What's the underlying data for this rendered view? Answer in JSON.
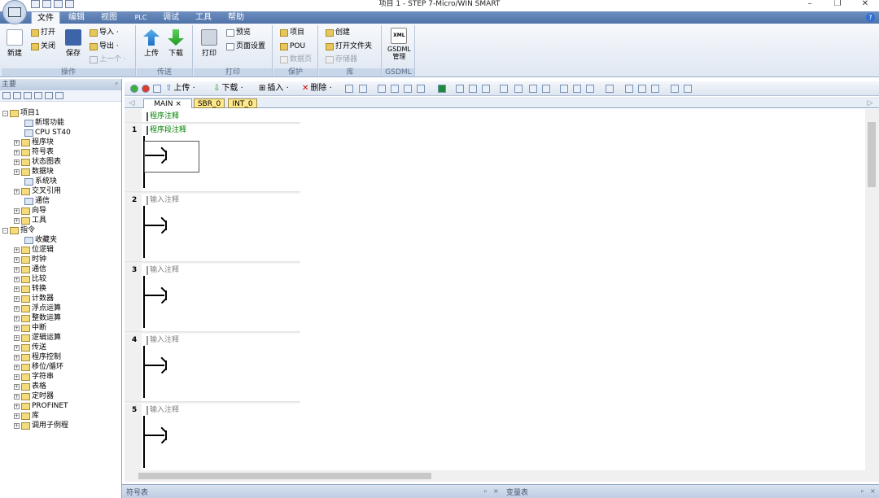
{
  "window": {
    "title": "项目 1 - STEP 7-Micro/WIN SMART",
    "min": "–",
    "restore": "❐",
    "close": "✕"
  },
  "menu": [
    "文件",
    "编辑",
    "视图",
    "PLC",
    "调试",
    "工具",
    "帮助"
  ],
  "help": "?",
  "ribbon": {
    "groups": [
      {
        "label": "操作"
      },
      {
        "label": "传送"
      },
      {
        "label": "打印"
      },
      {
        "label": "保护"
      },
      {
        "label": "库"
      },
      {
        "label": "GSDML"
      }
    ],
    "new": "新建",
    "open": "打开",
    "close": "关闭",
    "save": "保存",
    "import": "导入 ·",
    "export": "导出 ·",
    "prev": "上一个 ·",
    "upload": "上传",
    "download": "下载",
    "print": "打印",
    "preview": "预览",
    "page_setup": "页面设置",
    "project": "项目",
    "pou": "POU",
    "data_page": "数据页",
    "create": "创建",
    "open_folder": "打开文件夹",
    "memory": "存储器",
    "gsdml_line1": "GSDML",
    "gsdml_line2": "管理",
    "xml": "XML"
  },
  "left_panel": {
    "header": "主要",
    "tree": [
      {
        "label": "项目1",
        "x": 3,
        "exp": "-",
        "icon": true
      },
      {
        "label": "新增功能",
        "x": 30
      },
      {
        "label": "CPU ST40",
        "x": 30
      },
      {
        "label": "程序块",
        "x": 17,
        "exp": "+",
        "icon": true
      },
      {
        "label": "符号表",
        "x": 17,
        "exp": "+",
        "icon": true
      },
      {
        "label": "状态图表",
        "x": 17,
        "exp": "+",
        "icon": true
      },
      {
        "label": "数据块",
        "x": 17,
        "exp": "+",
        "icon": true
      },
      {
        "label": "系统块",
        "x": 30
      },
      {
        "label": "交叉引用",
        "x": 17,
        "exp": "+",
        "icon": true
      },
      {
        "label": "通信",
        "x": 30
      },
      {
        "label": "向导",
        "x": 17,
        "exp": "+",
        "icon": true
      },
      {
        "label": "工具",
        "x": 17,
        "exp": "+",
        "icon": true
      },
      {
        "label": "指令",
        "x": 3,
        "exp": "-",
        "icon": true
      },
      {
        "label": "收藏夹",
        "x": 30
      },
      {
        "label": "位逻辑",
        "x": 17,
        "exp": "+",
        "icon": true
      },
      {
        "label": "时钟",
        "x": 17,
        "exp": "+",
        "icon": true
      },
      {
        "label": "通信",
        "x": 17,
        "exp": "+",
        "icon": true
      },
      {
        "label": "比较",
        "x": 17,
        "exp": "+",
        "icon": true
      },
      {
        "label": "转换",
        "x": 17,
        "exp": "+",
        "icon": true
      },
      {
        "label": "计数器",
        "x": 17,
        "exp": "+",
        "icon": true
      },
      {
        "label": "浮点运算",
        "x": 17,
        "exp": "+",
        "icon": true
      },
      {
        "label": "整数运算",
        "x": 17,
        "exp": "+",
        "icon": true
      },
      {
        "label": "中断",
        "x": 17,
        "exp": "+",
        "icon": true
      },
      {
        "label": "逻辑运算",
        "x": 17,
        "exp": "+",
        "icon": true
      },
      {
        "label": "传送",
        "x": 17,
        "exp": "+",
        "icon": true
      },
      {
        "label": "程序控制",
        "x": 17,
        "exp": "+",
        "icon": true
      },
      {
        "label": "移位/循环",
        "x": 17,
        "exp": "+",
        "icon": true
      },
      {
        "label": "字符串",
        "x": 17,
        "exp": "+",
        "icon": true
      },
      {
        "label": "表格",
        "x": 17,
        "exp": "+",
        "icon": true
      },
      {
        "label": "定时器",
        "x": 17,
        "exp": "+",
        "icon": true
      },
      {
        "label": "PROFINET",
        "x": 17,
        "exp": "+",
        "icon": true
      },
      {
        "label": "库",
        "x": 17,
        "exp": "+",
        "icon": true
      },
      {
        "label": "调用子例程",
        "x": 17,
        "exp": "+",
        "icon": true
      }
    ]
  },
  "toolbar": {
    "upload": "上传 ·",
    "download": "下载 ·",
    "insert": "插入 ·",
    "delete": "删除 ·"
  },
  "tabs": {
    "main": "MAIN",
    "close": "×",
    "sbr": "SBR_0",
    "int": "INT_0",
    "left_arrow": "◁",
    "right_arrow": "▷"
  },
  "editor": {
    "program_comment": "程序注释",
    "rungs": [
      {
        "num": "1",
        "comment": "程序段注释"
      },
      {
        "num": "2",
        "comment": "输入注释"
      },
      {
        "num": "3",
        "comment": "输入注释"
      },
      {
        "num": "4",
        "comment": "输入注释"
      },
      {
        "num": "5",
        "comment": "输入注释"
      }
    ]
  },
  "bottom": {
    "symbol_table": "符号表",
    "var_table": "变量表",
    "pin": "ᵖ",
    "close": "×"
  },
  "colors": {
    "accent": "#4e72a8",
    "comment_green": "#008000",
    "tab_yellow": "#ffe98a"
  }
}
